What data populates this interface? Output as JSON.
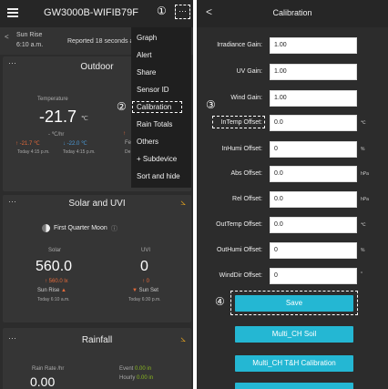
{
  "left": {
    "device_title": "GW3000B-WIFIB79F",
    "annotation_1": "①",
    "more_label": "···",
    "sunrise_label": "Sun Rise",
    "sunrise_time": "6:10 a.m.",
    "reported": "Reported 18 seconds ag",
    "outdoor": {
      "dots": "···",
      "title": "Outdoor",
      "temp_label": "Temperature",
      "temp_value": "-21.7",
      "temp_unit": "℃",
      "rate": "- ℃/hr",
      "max": "↑ -21.7 ℃",
      "min": "↓ -22.0 ℃",
      "max_time": "Today 4:15 p.m.",
      "min_time": "Today 4:15 p.m.",
      "fe": "Fe",
      "de": "De",
      "arrow": "↑"
    },
    "solar": {
      "dots": "···",
      "title": "Solar and UVI",
      "moon": "First Quarter Moon",
      "moon_info": "ⓘ",
      "solar_label": "Solar",
      "uvi_label": "UVI",
      "solar_value": "560.0",
      "uvi_value": "0",
      "solar_max": "↑ 560.0 lx",
      "uvi_max": "↑ 0",
      "sunrise": "Sun Rise",
      "sunset": "Sun Set",
      "sunrise_time": "Today 6:10 a.m.",
      "sunset_time": "Today 6:30 p.m."
    },
    "rainfall": {
      "dots": "···",
      "title": "Rainfall",
      "rate_label": "Rain Rate /hr",
      "event_label": "Event",
      "event_value": "0.00 in",
      "hourly_label": "Hourly",
      "hourly_value": "0.00 in",
      "rate_value": "0.00"
    },
    "menu": [
      "Graph",
      "Alert",
      "Share",
      "Sensor ID",
      "Calibration",
      "Rain Totals",
      "Others",
      "+ Subdevice",
      "Sort and hide"
    ],
    "annotation_2": "②"
  },
  "right": {
    "title": "Calibration",
    "back": "<",
    "fields": [
      {
        "label": "Irradiance Gain:",
        "value": "1.00",
        "unit": ""
      },
      {
        "label": "UV Gain:",
        "value": "1.00",
        "unit": ""
      },
      {
        "label": "Wind Gain:",
        "value": "1.00",
        "unit": ""
      },
      {
        "label": "InTemp Offset:",
        "value": "0.0",
        "unit": "℃"
      },
      {
        "label": "InHumi Offset:",
        "value": "0",
        "unit": "%"
      },
      {
        "label": "Abs Offset:",
        "value": "0.0",
        "unit": "hPa"
      },
      {
        "label": "Rel Offset:",
        "value": "0.0",
        "unit": "hPa"
      },
      {
        "label": "OutTemp Offset:",
        "value": "0.0",
        "unit": "℃"
      },
      {
        "label": "OutHumi Offset:",
        "value": "0",
        "unit": "%"
      },
      {
        "label": "WindDir Offset:",
        "value": "0",
        "unit": "°"
      }
    ],
    "annotation_3": "③",
    "annotation_4": "④",
    "save": "Save",
    "multi_soil": "Multi_CH Soil",
    "multi_th": "Multi_CH T&H Calibration"
  },
  "colors": {
    "accent": "#24b7d3",
    "high": "#e56a3a",
    "low": "#4a9ad8",
    "chart_icon": "#e0a020",
    "rain_green": "#8ab820"
  }
}
